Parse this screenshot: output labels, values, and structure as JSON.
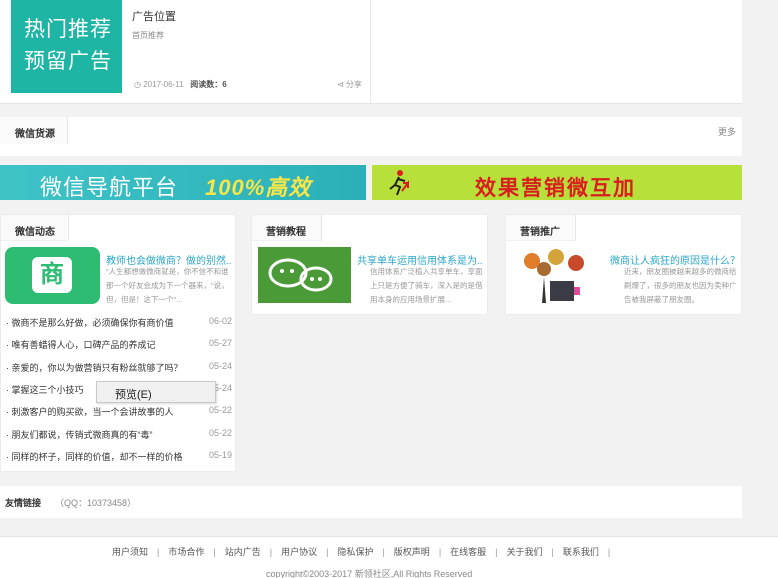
{
  "top_ad": {
    "image_line1": "热门推荐",
    "image_line2": "预留广告",
    "title": "广告位置",
    "subtitle": "首页推荐",
    "date": "2017-06-11",
    "views_label": "阅读数：",
    "views": "6",
    "share": "分享"
  },
  "wechat_source": {
    "tab": "微信货源",
    "more": "更多"
  },
  "banners": {
    "left_text": "微信导航平台",
    "left_highlight": "100%高效",
    "right_text": "效果营销微互加"
  },
  "columns": {
    "dynamics": {
      "tab": "微信动态",
      "feature_title": "教师也会做微商？做的别然...",
      "feature_desc": "\"人生都想做微商就是，你不信不和谁那一个好友会成为下一个器来，\"说，但，但是！这下一个\"...",
      "items": [
        {
          "text": "微商不是那么好做，必须确保你有商价值",
          "date": "06-02"
        },
        {
          "text": "唯有善蜡得人心，口碑产品的养成记",
          "date": "05-27"
        },
        {
          "text": "亲爱的，你以为做营销只有粉丝就够了吗？",
          "date": "05-24"
        },
        {
          "text": "掌握这三个小技巧",
          "date": "05-24"
        },
        {
          "text": "刺激客户的购买欲，当一个会讲故事的人",
          "date": "05-22"
        },
        {
          "text": "朋友们都说，传销式微商真的有“毒”",
          "date": "05-22"
        },
        {
          "text": "同样的杯子，同样的价值，却不一样的价格",
          "date": "05-19"
        }
      ]
    },
    "tutorial": {
      "tab": "营销教程",
      "feature_title": "共享单车运用信用体系是为...",
      "feature_desc": "信用体系广泛植入共享单车，享面上只是方便了骑车，深入是的是借用本身的应用场景扩展..."
    },
    "promotion": {
      "tab": "营销推广",
      "feature_title": "微商让人疯狂的原因是什么？",
      "feature_desc": "近来，朋友圈被越来越多的微商给刷爆了，很多的朋友也因为卖种广告被我屏蔽了朋友圈。"
    }
  },
  "context_menu": {
    "item": "预览(E)"
  },
  "links": {
    "tab": "友情链接",
    "qq": "（QQ：10373458）"
  },
  "footer": {
    "nav": [
      "用户须知",
      "市场合作",
      "站内广告",
      "用户协议",
      "隐私保护",
      "版权声明",
      "在线客服",
      "关于我们",
      "联系我们"
    ],
    "copyright": "copyright©2003-2017 新领社区,All Rights Reserved"
  },
  "colors": {
    "accent": "#2aa7c9",
    "teal": "#1fb5a5",
    "banner_green": "#b8e03a",
    "banner_red": "#d81e1e"
  }
}
